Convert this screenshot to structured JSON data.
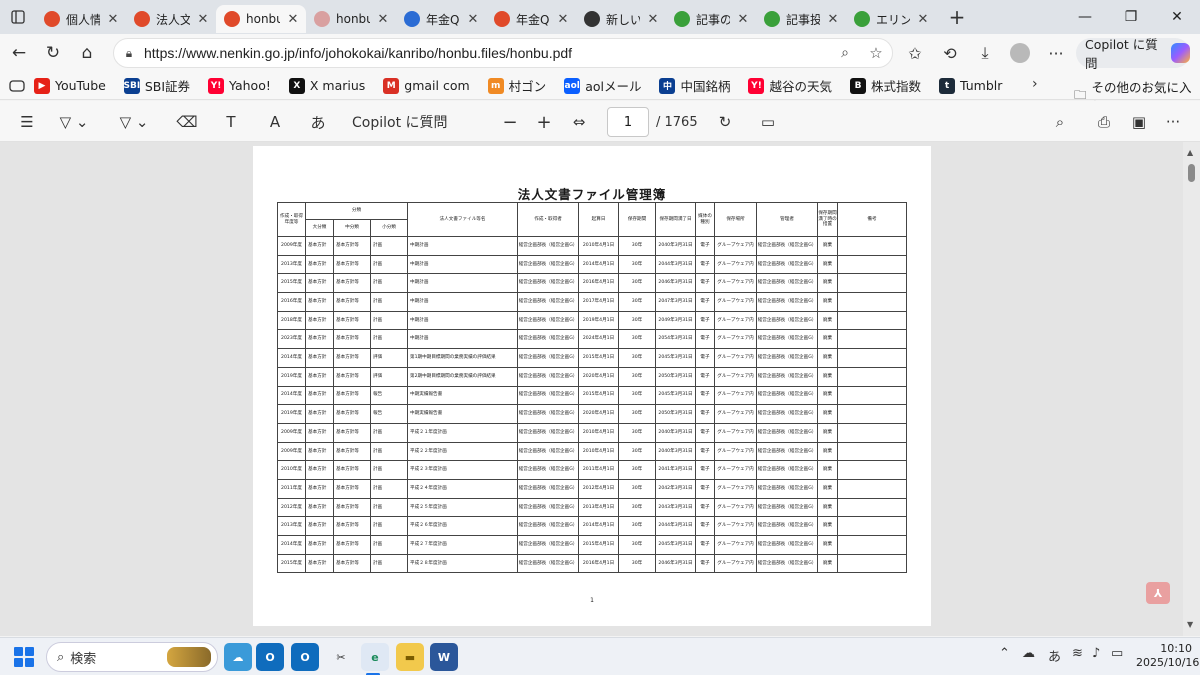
{
  "tabs": [
    {
      "title": "個人情",
      "favicon": "nenkin-icon",
      "color": "#e04a2a"
    },
    {
      "title": "法人文",
      "favicon": "nenkin-icon",
      "color": "#e04a2a"
    },
    {
      "title": "honbu",
      "favicon": "nenkin-icon",
      "color": "#e04a2a",
      "active": true
    },
    {
      "title": "honbu",
      "favicon": "nenkin-icon",
      "color": "#d9a0a0"
    },
    {
      "title": "年金Q",
      "favicon": "search-icon",
      "color": "#2b6cd4"
    },
    {
      "title": "年金Q",
      "favicon": "nenkin-icon",
      "color": "#e04a2a"
    },
    {
      "title": "新しい",
      "favicon": "newtab-icon",
      "color": "#333333"
    },
    {
      "title": "記事の",
      "favicon": "frog-icon",
      "color": "#3aa03a"
    },
    {
      "title": "記事投",
      "favicon": "frog-icon",
      "color": "#3aa03a"
    },
    {
      "title": "エリン",
      "favicon": "frog-icon",
      "color": "#3aa03a"
    }
  ],
  "address": {
    "url": "https://www.nenkin.go.jp/info/johokokai/kanribo/honbu.files/honbu.pdf",
    "copilot_label": "Copilot に質問"
  },
  "bookmarks": [
    {
      "label": "YouTube",
      "icon": "youtube-icon",
      "color": "#e62117",
      "glyph": "▶"
    },
    {
      "label": "SBI証券",
      "icon": "sbi-icon",
      "color": "#0b3f91",
      "glyph": "SBI"
    },
    {
      "label": "Yahoo!",
      "icon": "yahoo-icon",
      "color": "#ff0033",
      "glyph": "Y!"
    },
    {
      "label": "X marius",
      "icon": "x-icon",
      "color": "#111111",
      "glyph": "X"
    },
    {
      "label": "gmail com",
      "icon": "gmail-icon",
      "color": "#d93025",
      "glyph": "M"
    },
    {
      "label": "村ゴン",
      "icon": "blog-icon",
      "color": "#f08a24",
      "glyph": "m"
    },
    {
      "label": "aolメール",
      "icon": "aol-icon",
      "color": "#0b5fff",
      "glyph": "aol"
    },
    {
      "label": "中国銘柄",
      "icon": "stock-icon",
      "color": "#0b3f91",
      "glyph": "中"
    },
    {
      "label": "越谷の天気",
      "icon": "yahoo-icon",
      "color": "#ff0033",
      "glyph": "Y!"
    },
    {
      "label": "株式指数",
      "icon": "b-icon",
      "color": "#111111",
      "glyph": "B"
    },
    {
      "label": "Tumblr",
      "icon": "tumblr-icon",
      "color": "#1d2b3a",
      "glyph": "t"
    }
  ],
  "bookmarks_other": "その他のお気に入り",
  "pdf_toolbar": {
    "copilot_label": "Copilot に質問",
    "page_current": "1",
    "page_total": "/ 1765",
    "zoom_out": "−",
    "zoom_in": "+",
    "read_aloud": "A",
    "translate": "あ"
  },
  "document": {
    "title": "法人文書ファイル管理簿",
    "page_number": "1",
    "headers": {
      "year": "作成・取得年度等",
      "bunrui": "分類",
      "dai": "大分類",
      "chu": "中分類",
      "sho": "小分類",
      "name": "法人文書ファイル等名",
      "creator": "作成・取得者",
      "start": "起算日",
      "period": "保存期間",
      "expiry": "保存期間満了日",
      "medium": "媒体の種別",
      "place": "保存場所",
      "manager": "管理者",
      "action": "保存期間満了時の措置",
      "note": "備考"
    },
    "rows": [
      [
        "2009年度",
        "基本方針",
        "基本方針等",
        "計画",
        "中期計画",
        "経営企画部長（経営企画G）",
        "2010年4月1日",
        "30年",
        "2040年3月31日",
        "電子",
        "グループウェア内",
        "経営企画部長（経営企画G）",
        "廃棄",
        ""
      ],
      [
        "2013年度",
        "基本方針",
        "基本方針等",
        "計画",
        "中期計画",
        "経営企画部長（経営企画G）",
        "2014年4月1日",
        "30年",
        "2044年3月31日",
        "電子",
        "グループウェア内",
        "経営企画部長（経営企画G）",
        "廃棄",
        ""
      ],
      [
        "2015年度",
        "基本方針",
        "基本方針等",
        "計画",
        "中期計画",
        "経営企画部長（経営企画G）",
        "2016年4月1日",
        "30年",
        "2046年3月31日",
        "電子",
        "グループウェア内",
        "経営企画部長（経営企画G）",
        "廃棄",
        ""
      ],
      [
        "2016年度",
        "基本方針",
        "基本方針等",
        "計画",
        "中期計画",
        "経営企画部長（経営企画G）",
        "2017年4月1日",
        "30年",
        "2047年3月31日",
        "電子",
        "グループウェア内",
        "経営企画部長（経営企画G）",
        "廃棄",
        ""
      ],
      [
        "2018年度",
        "基本方針",
        "基本方針等",
        "計画",
        "中期計画",
        "経営企画部長（経営企画G）",
        "2019年4月1日",
        "30年",
        "2049年3月31日",
        "電子",
        "グループウェア内",
        "経営企画部長（経営企画G）",
        "廃棄",
        ""
      ],
      [
        "2023年度",
        "基本方針",
        "基本方針等",
        "計画",
        "中期計画",
        "経営企画部長（経営企画G）",
        "2024年4月1日",
        "30年",
        "2054年3月31日",
        "電子",
        "グループウェア内",
        "経営企画部長（経営企画G）",
        "廃棄",
        ""
      ],
      [
        "2014年度",
        "基本方針",
        "基本方針等",
        "評価",
        "第1期中期目標期間の業務実績の評価結果",
        "経営企画部長（経営企画G）",
        "2015年4月1日",
        "30年",
        "2045年3月31日",
        "電子",
        "グループウェア内",
        "経営企画部長（経営企画G）",
        "廃棄",
        ""
      ],
      [
        "2019年度",
        "基本方針",
        "基本方針等",
        "評価",
        "第2期中期目標期間の業務実績の評価結果",
        "経営企画部長（経営企画G）",
        "2020年4月1日",
        "30年",
        "2050年3月31日",
        "電子",
        "グループウェア内",
        "経営企画部長（経営企画G）",
        "廃棄",
        ""
      ],
      [
        "2014年度",
        "基本方針",
        "基本方針等",
        "報告",
        "中期実績報告書",
        "経営企画部長（経営企画G）",
        "2015年4月1日",
        "30年",
        "2045年3月31日",
        "電子",
        "グループウェア内",
        "経営企画部長（経営企画G）",
        "廃棄",
        ""
      ],
      [
        "2019年度",
        "基本方針",
        "基本方針等",
        "報告",
        "中期実績報告書",
        "経営企画部長（経営企画G）",
        "2020年4月1日",
        "30年",
        "2050年3月31日",
        "電子",
        "グループウェア内",
        "経営企画部長（経営企画G）",
        "廃棄",
        ""
      ],
      [
        "2009年度",
        "基本方針",
        "基本方針等",
        "計画",
        "平成２１年度計画",
        "経営企画部長（経営企画G）",
        "2010年4月1日",
        "30年",
        "2040年3月31日",
        "電子",
        "グループウェア内",
        "経営企画部長（経営企画G）",
        "廃棄",
        ""
      ],
      [
        "2009年度",
        "基本方針",
        "基本方針等",
        "計画",
        "平成２２年度計画",
        "経営企画部長（経営企画G）",
        "2010年4月1日",
        "30年",
        "2040年3月31日",
        "電子",
        "グループウェア内",
        "経営企画部長（経営企画G）",
        "廃棄",
        ""
      ],
      [
        "2010年度",
        "基本方針",
        "基本方針等",
        "計画",
        "平成２３年度計画",
        "経営企画部長（経営企画G）",
        "2011年4月1日",
        "30年",
        "2041年3月31日",
        "電子",
        "グループウェア内",
        "経営企画部長（経営企画G）",
        "廃棄",
        ""
      ],
      [
        "2011年度",
        "基本方針",
        "基本方針等",
        "計画",
        "平成２４年度計画",
        "経営企画部長（経営企画G）",
        "2012年4月1日",
        "30年",
        "2042年3月31日",
        "電子",
        "グループウェア内",
        "経営企画部長（経営企画G）",
        "廃棄",
        ""
      ],
      [
        "2012年度",
        "基本方針",
        "基本方針等",
        "計画",
        "平成２５年度計画",
        "経営企画部長（経営企画G）",
        "2013年4月1日",
        "30年",
        "2043年3月31日",
        "電子",
        "グループウェア内",
        "経営企画部長（経営企画G）",
        "廃棄",
        ""
      ],
      [
        "2013年度",
        "基本方針",
        "基本方針等",
        "計画",
        "平成２６年度計画",
        "経営企画部長（経営企画G）",
        "2014年4月1日",
        "30年",
        "2044年3月31日",
        "電子",
        "グループウェア内",
        "経営企画部長（経営企画G）",
        "廃棄",
        ""
      ],
      [
        "2014年度",
        "基本方針",
        "基本方針等",
        "計画",
        "平成２７年度計画",
        "経営企画部長（経営企画G）",
        "2015年4月1日",
        "30年",
        "2045年3月31日",
        "電子",
        "グループウェア内",
        "経営企画部長（経営企画G）",
        "廃棄",
        ""
      ],
      [
        "2015年度",
        "基本方針",
        "基本方針等",
        "計画",
        "平成２８年度計画",
        "経営企画部長（経営企画G）",
        "2016年4月1日",
        "30年",
        "2046年3月31日",
        "電子",
        "グループウェア内",
        "経営企画部長（経営企画G）",
        "廃棄",
        ""
      ]
    ]
  },
  "taskbar": {
    "search_placeholder": "検索",
    "ime": "あ",
    "time": "10:10",
    "date": "2025/10/16"
  }
}
